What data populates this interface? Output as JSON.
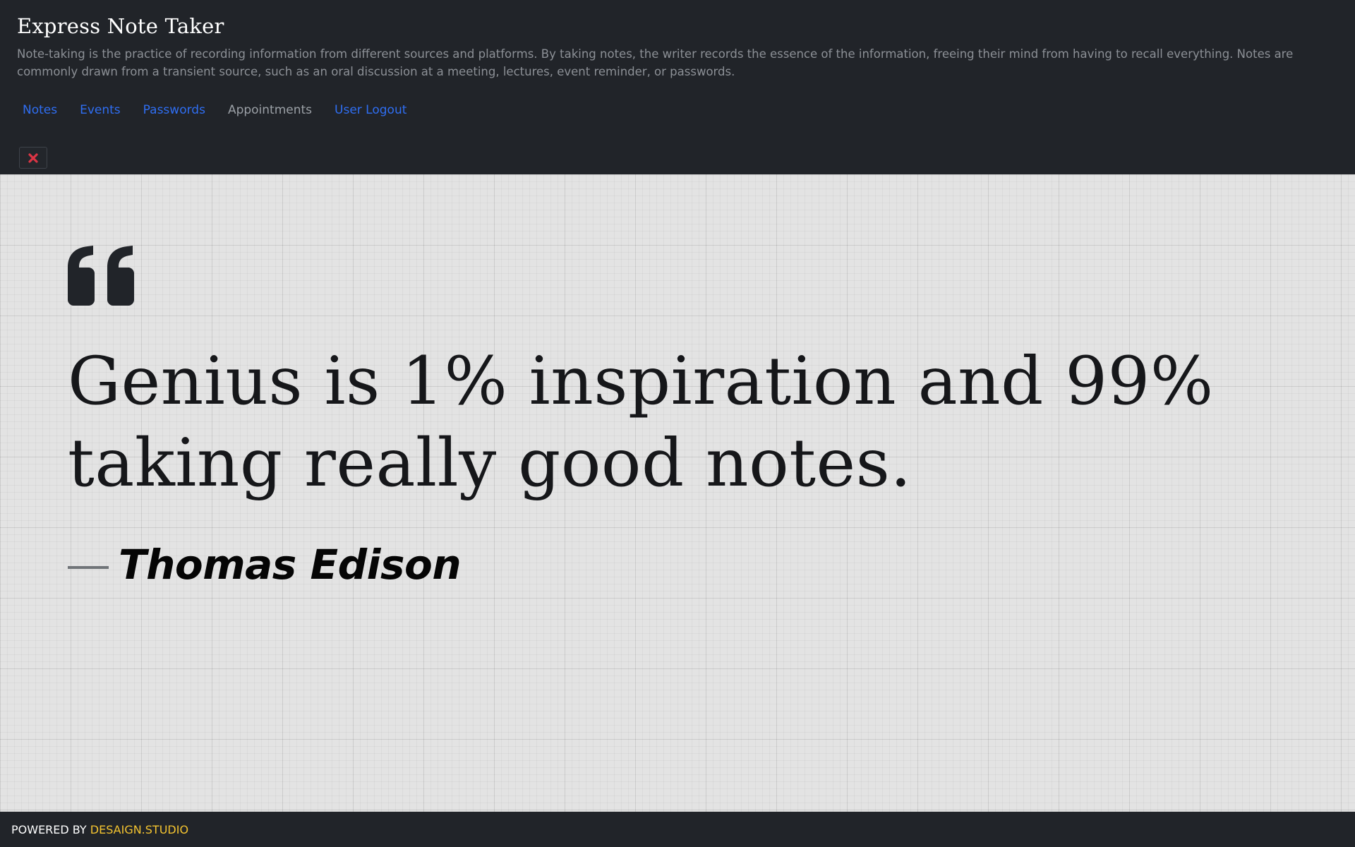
{
  "header": {
    "title": "Express Note Taker",
    "description": "Note-taking is the practice of recording information from different sources and platforms. By taking notes, the writer records the essence of the information, freeing their mind from having to recall everything. Notes are commonly drawn from a transient source, such as an oral discussion at a meeting, lectures, event reminder, or passwords."
  },
  "nav": {
    "items": [
      {
        "label": "Notes"
      },
      {
        "label": "Events"
      },
      {
        "label": "Passwords"
      },
      {
        "label": "Appointments",
        "active": true
      },
      {
        "label": "User Logout"
      }
    ]
  },
  "close_button": {
    "icon": "close-icon",
    "color": "#dc3545"
  },
  "quote": {
    "icon": "quote-icon",
    "text": "Genius is 1% inspiration and 99% taking really good notes.",
    "author": "Thomas Edison"
  },
  "footer": {
    "prefix": "POWERED BY ",
    "link_text": "DESAIGN.STUDIO",
    "link_color": "#f4c430"
  },
  "colors": {
    "header_bg": "#212429",
    "link": "#2f6ef2",
    "active_link": "#9ba0a6",
    "main_bg": "#e3e3e3"
  }
}
